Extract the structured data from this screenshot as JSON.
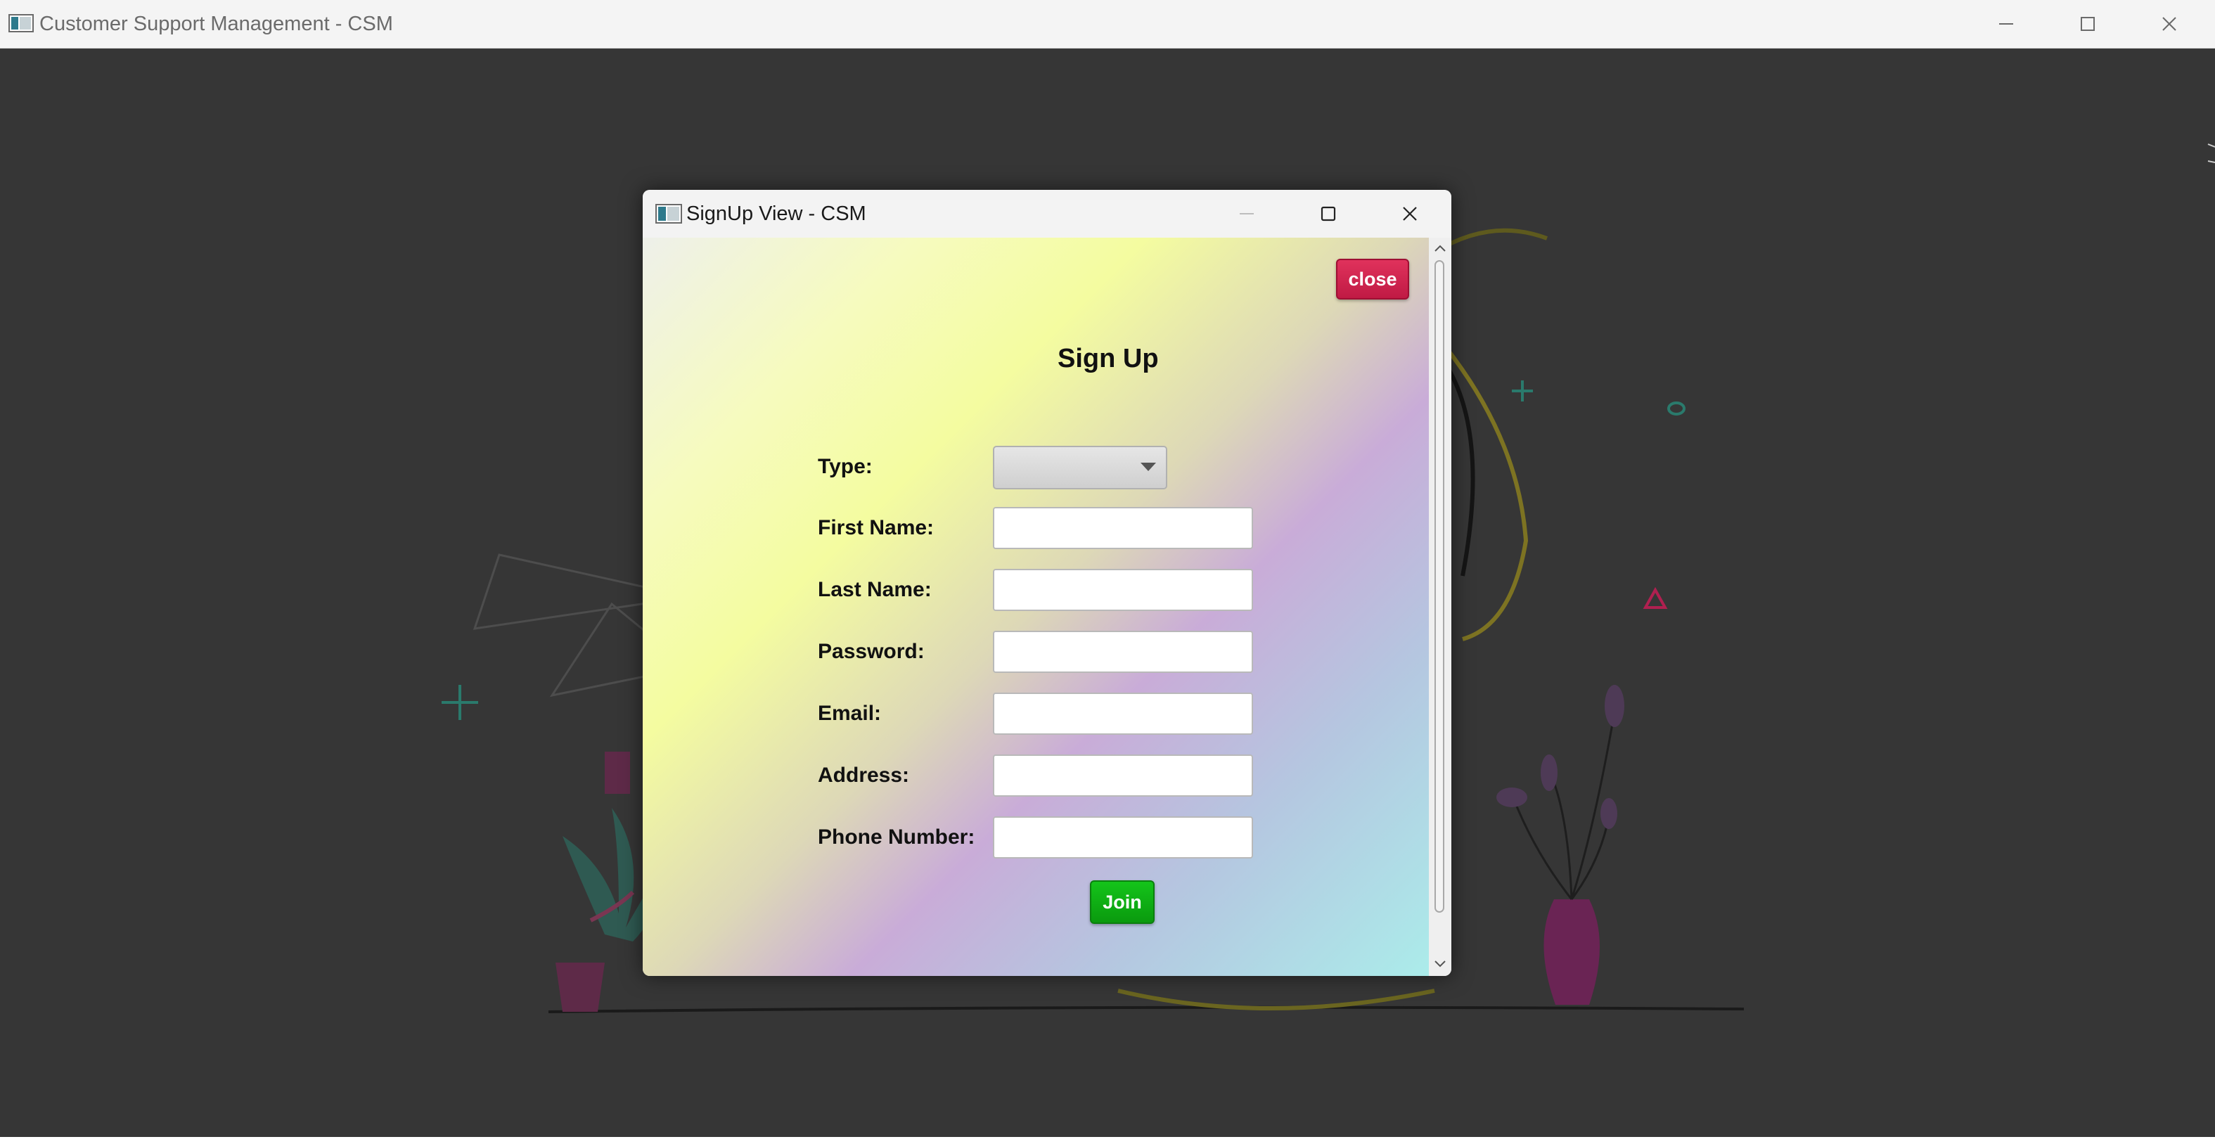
{
  "main_window": {
    "title": "Customer Support Management - CSM",
    "controls": [
      "minimize-icon",
      "maximize-icon",
      "close-icon"
    ]
  },
  "dialog": {
    "title": "SignUp View - CSM",
    "close_button_label": "close",
    "heading": "Sign Up",
    "fields": {
      "type_label": "Type:",
      "type_value": "",
      "first_name_label": "First Name:",
      "first_name_value": "",
      "last_name_label": "Last Name:",
      "last_name_value": "",
      "password_label": "Password:",
      "password_value": "",
      "email_label": "Email:",
      "email_value": "",
      "address_label": "Address:",
      "address_value": "",
      "phone_label": "Phone Number:",
      "phone_value": ""
    },
    "join_button_label": "Join"
  },
  "colors": {
    "close_button": "#d42450",
    "join_button": "#0fae14",
    "background": "#363636"
  }
}
